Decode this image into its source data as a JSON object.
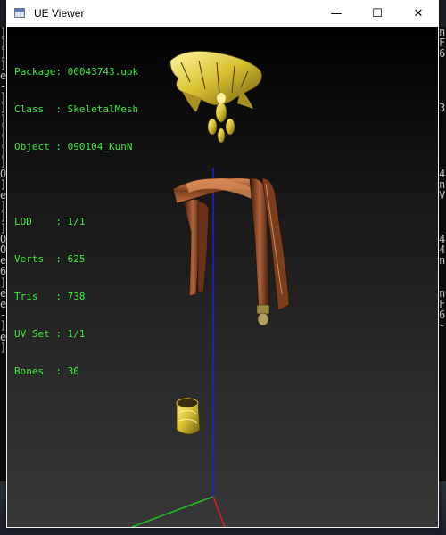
{
  "window": {
    "title": "UE Viewer",
    "controls": {
      "minimize": "—",
      "maximize": "☐",
      "close": "✕"
    }
  },
  "info": {
    "package": "Package: 00043743.upk",
    "class": "Class  : SkeletalMesh",
    "object": "Object : 090104_KunN",
    "lod": "LOD    : 1/1",
    "verts": "Verts  : 625",
    "tris": "Tris   : 738",
    "uvset": "UV Set : 1/1",
    "bones": "Bones  : 30"
  },
  "background_console": {
    "left_chars": [
      "]",
      "]",
      "]",
      "]",
      "e",
      "-",
      "]",
      "]",
      "]",
      "]",
      "]",
      "]",
      "]",
      "O",
      "]",
      "e",
      "]",
      "]",
      "]",
      "O",
      "O",
      "e",
      "6",
      "]",
      "e",
      "e",
      "-",
      "]",
      "e",
      "]"
    ],
    "right_chars": [
      "n",
      "F",
      "6",
      "",
      "",
      "",
      "",
      "3",
      "",
      "",
      "",
      "",
      "",
      "4",
      "n",
      "V",
      "",
      "",
      "",
      "4",
      "4",
      "n",
      "",
      "",
      "n",
      "F",
      "6",
      "-",
      "",
      ""
    ]
  },
  "colors": {
    "text_green": "#3ee83e",
    "axis_x": "#e02020",
    "axis_y": "#20c020",
    "axis_z": "#2020e0",
    "gold": "#d8c030",
    "leather": "#8a4a22"
  }
}
